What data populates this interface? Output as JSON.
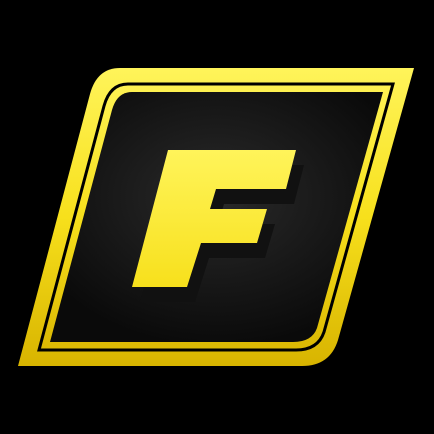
{
  "icon": {
    "name": "f-logo-icon",
    "letter": "F"
  },
  "colors": {
    "background": "#000000",
    "frame_yellow": "#f7e01c",
    "frame_yellow_light": "#fff45a",
    "frame_yellow_dark": "#d8b400",
    "panel_inner": "#2a2a2a",
    "panel_dark": "#0a0a0a",
    "letter_shadow": "#111111"
  }
}
